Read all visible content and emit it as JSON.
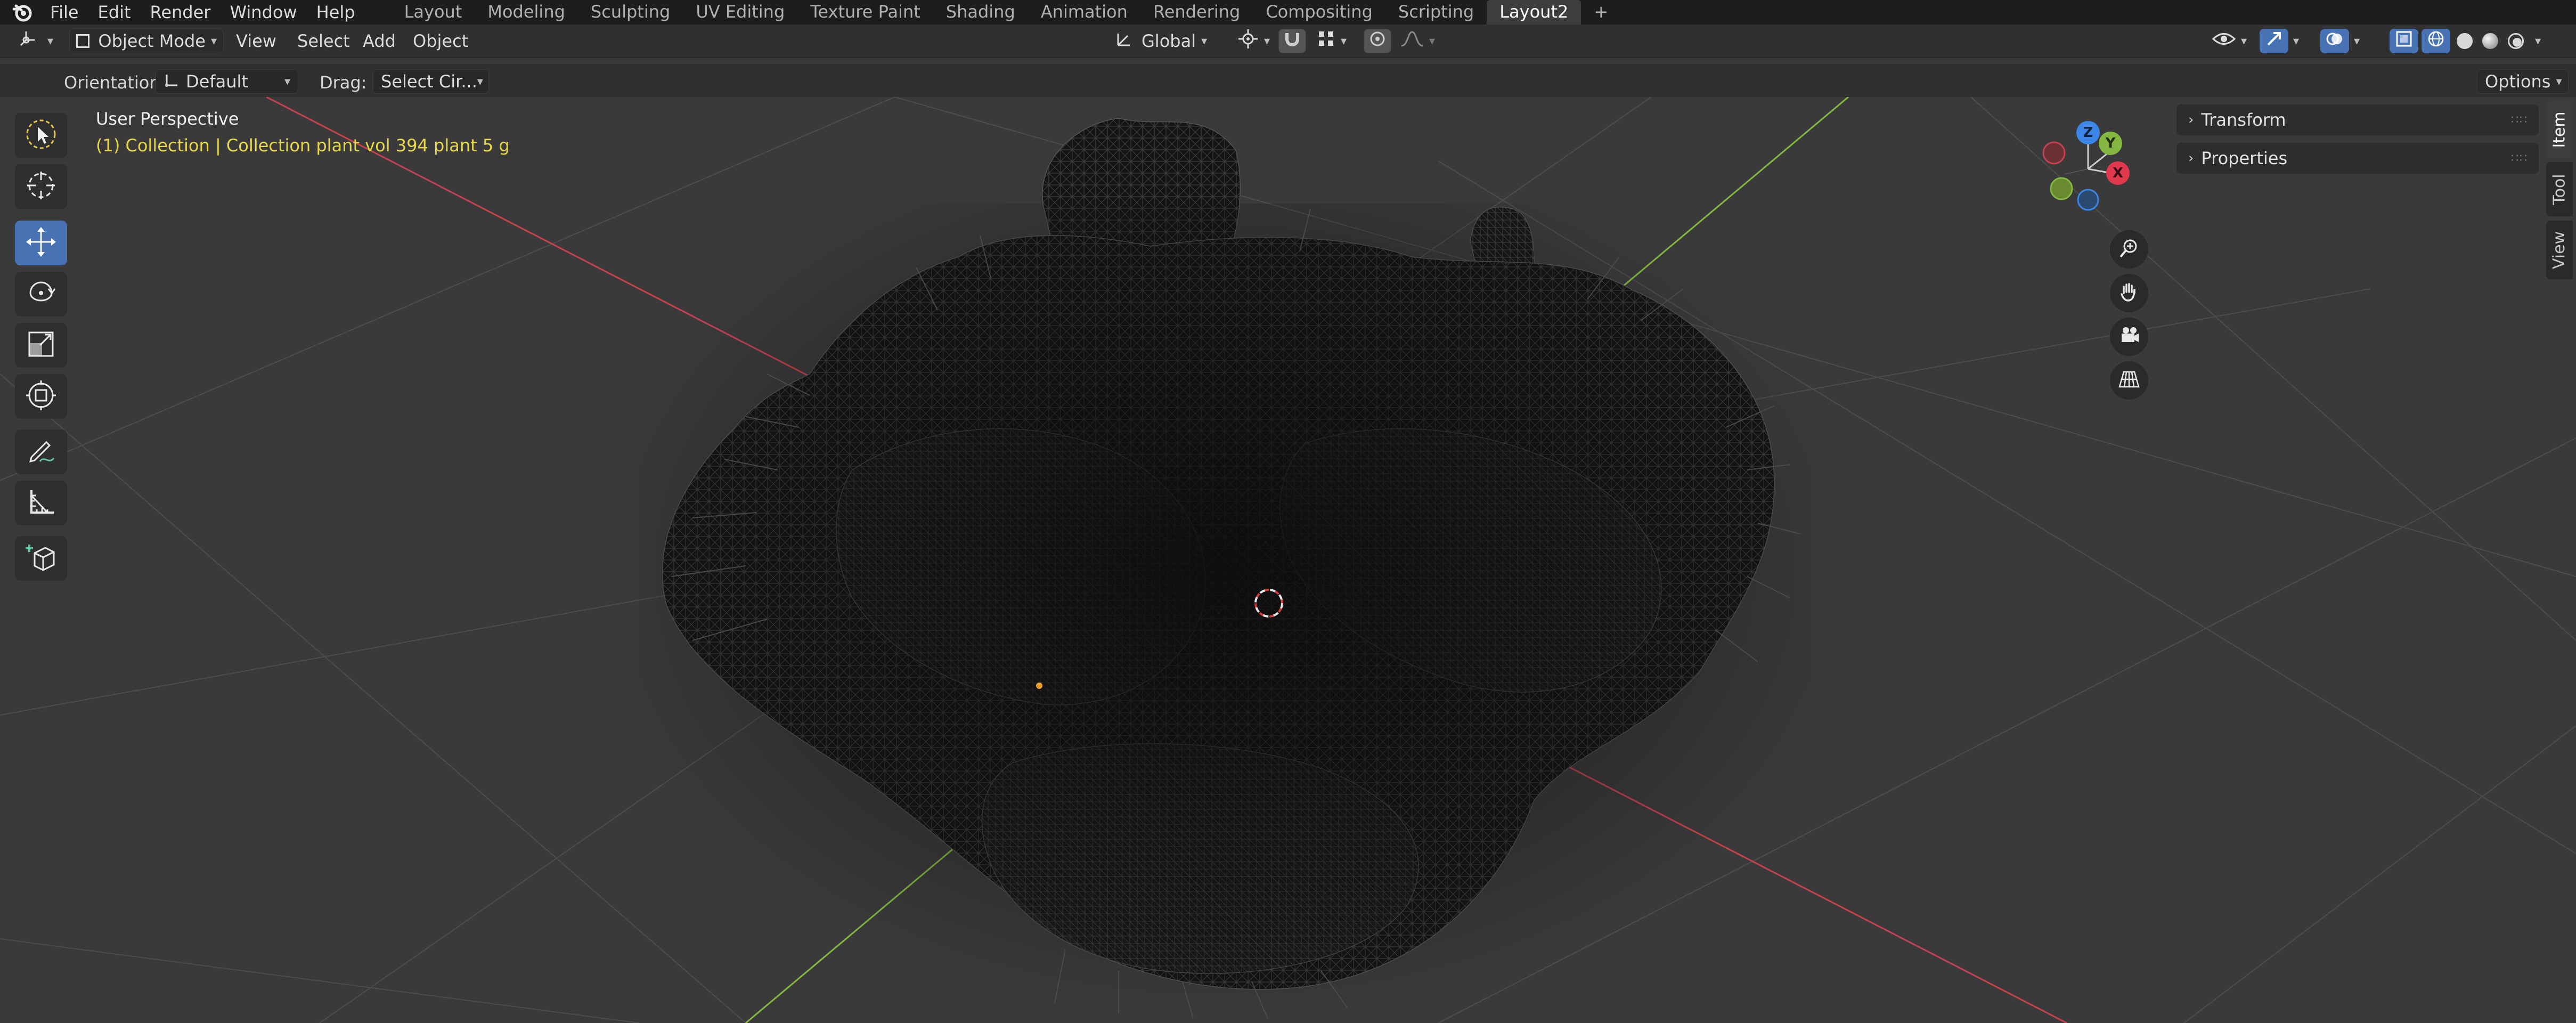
{
  "menubar": {
    "items": [
      "File",
      "Edit",
      "Render",
      "Window",
      "Help"
    ],
    "workspaces": [
      "Layout",
      "Modeling",
      "Sculpting",
      "UV Editing",
      "Texture Paint",
      "Shading",
      "Animation",
      "Rendering",
      "Compositing",
      "Scripting",
      "Layout2"
    ],
    "active_workspace": "Layout2",
    "add_tab": "+"
  },
  "header": {
    "mode": "Object Mode",
    "menus": [
      "View",
      "Select",
      "Add",
      "Object"
    ],
    "transform_orientation": "Global",
    "options_label": "Options"
  },
  "tool_settings": {
    "orientation_label": "Orientation:",
    "orientation_value": "Default",
    "drag_label": "Drag:",
    "drag_value": "Select Cir..."
  },
  "viewport": {
    "view_name": "User Perspective",
    "collection_info": "(1) Collection | Collection plant vol 394 plant 5 g",
    "info_color": "#e6d84a",
    "axis_colors": {
      "x": "#d03a48",
      "y": "#7fb13a",
      "z": "#3c86e8"
    }
  },
  "toolbar": {
    "tools": [
      "select-box",
      "cursor",
      "move",
      "rotate",
      "scale",
      "transform",
      "annotate",
      "measure",
      "add-cube"
    ],
    "active_tool": "move"
  },
  "gizmo": {
    "x_label": "X",
    "y_label": "Y",
    "z_label": "Z"
  },
  "npanel": {
    "sections": [
      "Transform",
      "Properties"
    ],
    "tabs": [
      "Item",
      "Tool",
      "View"
    ],
    "active_tab": "Item"
  }
}
